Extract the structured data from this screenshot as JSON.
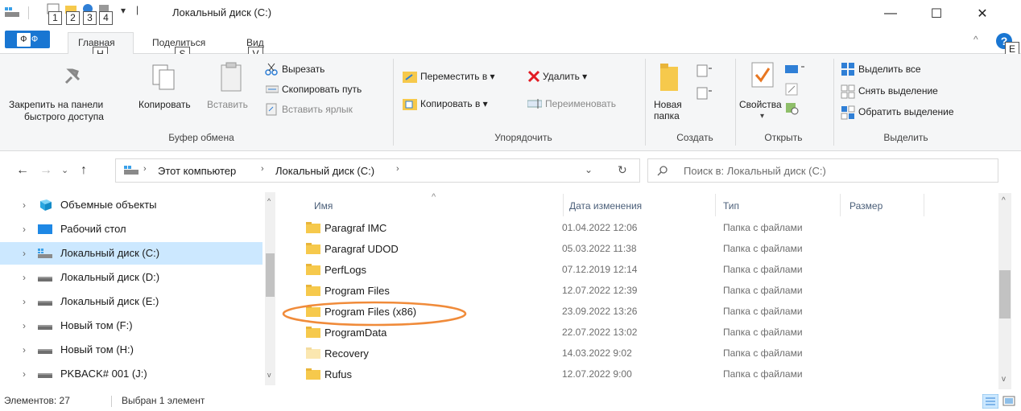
{
  "window": {
    "title": "Локальный диск (C:)",
    "quick_access_keys": [
      "1",
      "2",
      "3",
      "4"
    ],
    "minimize": "—",
    "maximize": "☐",
    "close": "✕"
  },
  "ribbon_tabs": {
    "file": "Ф",
    "file_key": "Ф",
    "home": "Главная",
    "home_key": "H",
    "share": "Поделиться",
    "share_key": "S",
    "view": "Вид",
    "view_key": "V",
    "help_key": "E"
  },
  "clipboard": {
    "pin": [
      "Закрепить на панели",
      "быстрого доступа"
    ],
    "copy": "Копировать",
    "paste": "Вставить",
    "cut": "Вырезать",
    "copy_path": "Скопировать путь",
    "paste_shortcut": "Вставить ярлык",
    "label": "Буфер обмена"
  },
  "organize": {
    "move_to": "Переместить в ▾",
    "copy_to": "Копировать в ▾",
    "delete": "Удалить ▾",
    "rename": "Переименовать",
    "label": "Упорядочить"
  },
  "create": {
    "new_folder": [
      "Новая",
      "папка"
    ],
    "label": "Создать"
  },
  "open": {
    "properties": "Свойства",
    "label": "Открыть"
  },
  "select": {
    "select_all": "Выделить все",
    "select_none": "Снять выделение",
    "invert": "Обратить выделение",
    "label": "Выделить"
  },
  "address": {
    "crumb_computer": "Этот компьютер",
    "crumb_drive": "Локальный диск (C:)",
    "search_placeholder": "Поиск в: Локальный диск (C:)"
  },
  "tree": [
    {
      "label": "Объемные объекты",
      "icon": "3d-objects-icon"
    },
    {
      "label": "Рабочий стол",
      "icon": "desktop-icon"
    },
    {
      "label": "Локальный диск (C:)",
      "icon": "system-drive-icon",
      "selected": true
    },
    {
      "label": "Локальный диск (D:)",
      "icon": "drive-icon"
    },
    {
      "label": "Локальный диск (E:)",
      "icon": "drive-icon"
    },
    {
      "label": "Новый том (F:)",
      "icon": "drive-icon"
    },
    {
      "label": "Новый том (H:)",
      "icon": "drive-icon"
    },
    {
      "label": "PKBACK# 001 (J:)",
      "icon": "drive-icon"
    }
  ],
  "columns": {
    "name": "Имя",
    "date": "Дата изменения",
    "type": "Тип",
    "size": "Размер"
  },
  "files": [
    {
      "name": "Paragraf IMC",
      "date": "01.04.2022 12:06",
      "type": "Папка с файлами"
    },
    {
      "name": "Paragraf UDOD",
      "date": "05.03.2022 11:38",
      "type": "Папка с файлами"
    },
    {
      "name": "PerfLogs",
      "date": "07.12.2019 12:14",
      "type": "Папка с файлами"
    },
    {
      "name": "Program Files",
      "date": "12.07.2022 12:39",
      "type": "Папка с файлами"
    },
    {
      "name": "Program Files (x86)",
      "date": "23.09.2022 13:26",
      "type": "Папка с файлами"
    },
    {
      "name": "ProgramData",
      "date": "22.07.2022 13:02",
      "type": "Папка с файлами"
    },
    {
      "name": "Recovery",
      "date": "14.03.2022 9:02",
      "type": "Папка с файлами"
    },
    {
      "name": "Rufus",
      "date": "12.07.2022 9:00",
      "type": "Папка с файлами"
    }
  ],
  "status": {
    "count": "Элементов: 27",
    "selection": "Выбран 1 элемент"
  },
  "colors": {
    "accent": "#1976d2",
    "selection": "#cce8ff",
    "folder": "#f6c94c",
    "annotation": "#f08b3a"
  }
}
